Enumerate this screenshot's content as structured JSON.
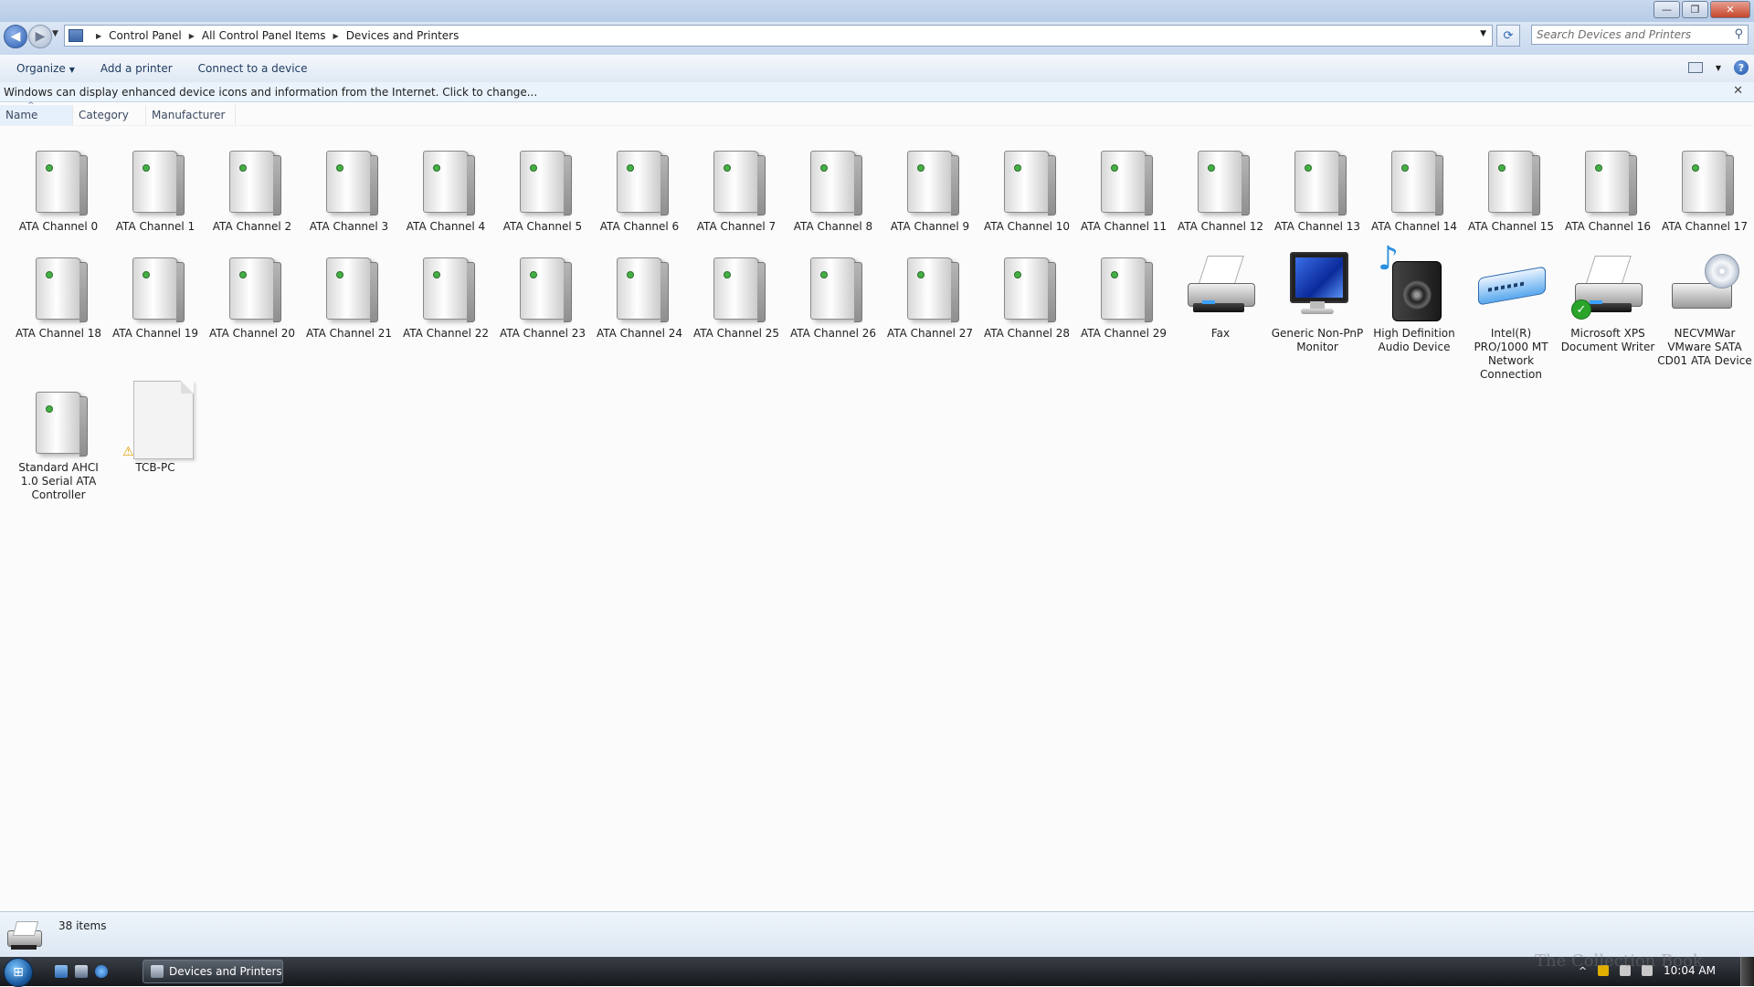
{
  "window": {
    "minimize": "—",
    "maximize": "❐",
    "close": "✕"
  },
  "address": {
    "crumbs": [
      "Control Panel",
      "All Control Panel Items",
      "Devices and Printers"
    ],
    "search_placeholder": "Search Devices and Printers"
  },
  "toolbar": {
    "organize": "Organize",
    "add_printer": "Add a printer",
    "connect_device": "Connect to a device"
  },
  "infobar": {
    "message": "Windows can display enhanced device icons and information from the Internet. Click to change..."
  },
  "columns": [
    "Name",
    "Category",
    "Manufacturer"
  ],
  "items": [
    {
      "label": "ATA Channel 0",
      "icon": "drive-icon"
    },
    {
      "label": "ATA Channel 1",
      "icon": "drive-icon"
    },
    {
      "label": "ATA Channel 2",
      "icon": "drive-icon"
    },
    {
      "label": "ATA Channel 3",
      "icon": "drive-icon"
    },
    {
      "label": "ATA Channel 4",
      "icon": "drive-icon"
    },
    {
      "label": "ATA Channel 5",
      "icon": "drive-icon"
    },
    {
      "label": "ATA Channel 6",
      "icon": "drive-icon"
    },
    {
      "label": "ATA Channel 7",
      "icon": "drive-icon"
    },
    {
      "label": "ATA Channel 8",
      "icon": "drive-icon"
    },
    {
      "label": "ATA Channel 9",
      "icon": "drive-icon"
    },
    {
      "label": "ATA Channel 10",
      "icon": "drive-icon"
    },
    {
      "label": "ATA Channel 11",
      "icon": "drive-icon"
    },
    {
      "label": "ATA Channel 12",
      "icon": "drive-icon"
    },
    {
      "label": "ATA Channel 13",
      "icon": "drive-icon"
    },
    {
      "label": "ATA Channel 14",
      "icon": "drive-icon"
    },
    {
      "label": "ATA Channel 15",
      "icon": "drive-icon"
    },
    {
      "label": "ATA Channel 16",
      "icon": "drive-icon"
    },
    {
      "label": "ATA Channel 17",
      "icon": "drive-icon"
    },
    {
      "label": "ATA Channel 18",
      "icon": "drive-icon"
    },
    {
      "label": "ATA Channel 19",
      "icon": "drive-icon"
    },
    {
      "label": "ATA Channel 20",
      "icon": "drive-icon"
    },
    {
      "label": "ATA Channel 21",
      "icon": "drive-icon"
    },
    {
      "label": "ATA Channel 22",
      "icon": "drive-icon"
    },
    {
      "label": "ATA Channel 23",
      "icon": "drive-icon"
    },
    {
      "label": "ATA Channel 24",
      "icon": "drive-icon"
    },
    {
      "label": "ATA Channel 25",
      "icon": "drive-icon"
    },
    {
      "label": "ATA Channel 26",
      "icon": "drive-icon"
    },
    {
      "label": "ATA Channel 27",
      "icon": "drive-icon"
    },
    {
      "label": "ATA Channel 28",
      "icon": "drive-icon"
    },
    {
      "label": "ATA Channel 29",
      "icon": "drive-icon"
    },
    {
      "label": "Fax",
      "icon": "fax-icon"
    },
    {
      "label": "Generic Non-PnP Monitor",
      "icon": "monitor-icon"
    },
    {
      "label": "High Definition Audio Device",
      "icon": "speaker-icon"
    },
    {
      "label": "Intel(R) PRO/1000 MT Network Connection",
      "icon": "network-adapter-icon"
    },
    {
      "label": "Microsoft XPS Document Writer",
      "icon": "printer-icon"
    },
    {
      "label": "NECVMWar VMware SATA CD01 ATA Device",
      "icon": "cd-drive-icon"
    },
    {
      "label": "Standard AHCI 1.0 Serial ATA Controller",
      "icon": "drive-icon"
    },
    {
      "label": "TCB-PC",
      "icon": "computer-icon"
    }
  ],
  "status": {
    "count": "38 items"
  },
  "taskbar": {
    "task_label": "Devices and Printers",
    "clock": "10:04 AM"
  },
  "watermark": "The Collection Book"
}
